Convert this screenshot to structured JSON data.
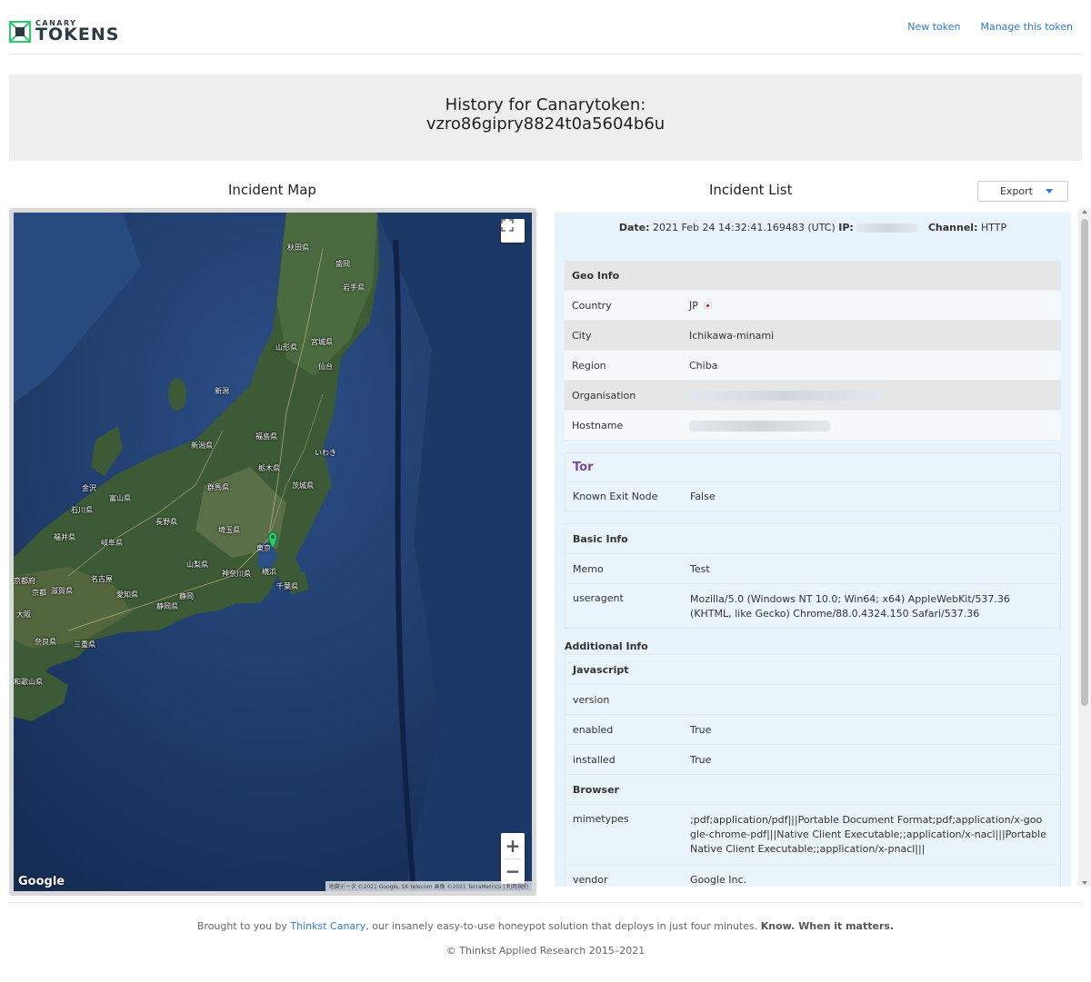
{
  "header": {
    "logo_small": "CANARY",
    "logo_big": "TOKENS",
    "nav": [
      "New token",
      "Manage this token"
    ]
  },
  "banner": {
    "line1": "History for Canarytoken:",
    "line2": "vzro86gipry8824t0a5604b6u"
  },
  "map": {
    "title": "Incident Map",
    "google_label": "Google",
    "attribution": "地図データ ©2021 Google, SK telecom 画像 ©2021 TerraMetrics  |  利用規約",
    "cities": [
      "秋田県",
      "盛岡",
      "岩手県",
      "山形県",
      "宮城県",
      "仙台",
      "新潟",
      "福島県",
      "新潟県",
      "栃木県",
      "いわき",
      "金沢",
      "富山県",
      "石川県",
      "群馬県",
      "茨城県",
      "長野県",
      "福井県",
      "岐阜県",
      "埼玉県",
      "東京",
      "山梨県",
      "神奈川県",
      "横浜",
      "千葉県",
      "京都府",
      "名古屋",
      "京都",
      "滋賀県",
      "愛知県",
      "静岡県",
      "静岡",
      "大阪",
      "奈良県",
      "三重県",
      "和歌山県"
    ]
  },
  "list": {
    "title": "Incident List",
    "export_label": "Export",
    "meta": {
      "date_label": "Date:",
      "date_value": "2021 Feb 24 14:32:41.169483 (UTC)",
      "ip_label": "IP:",
      "channel_label": "Channel:",
      "channel_value": "HTTP"
    },
    "geo": {
      "heading": "Geo Info",
      "country_k": "Country",
      "country_v": "JP",
      "city_k": "City",
      "city_v": "Ichikawa-minami",
      "region_k": "Region",
      "region_v": "Chiba",
      "org_k": "Organisation",
      "host_k": "Hostname"
    },
    "tor": {
      "logo": "Tor",
      "exit_k": "Known Exit Node",
      "exit_v": "False"
    },
    "basic": {
      "heading": "Basic Info",
      "memo_k": "Memo",
      "memo_v": "Test",
      "ua_k": "useragent",
      "ua_v": "Mozilla/5.0 (Windows NT 10.0; Win64; x64) AppleWebKit/537.36 (KHTML, like Gecko) Chrome/88.0.4324.150 Safari/537.36"
    },
    "additional": {
      "heading": "Additional Info",
      "js_heading": "Javascript",
      "version_k": "version",
      "version_v": "",
      "enabled_k": "enabled",
      "enabled_v": "True",
      "installed_k": "installed",
      "installed_v": "True",
      "browser_heading": "Browser",
      "mime_k": "mimetypes",
      "mime_v": ";pdf;application/pdf|||Portable Document Format;pdf;application/x-google-chrome-pdf|||Native Client Executable;;application/x-nacl|||Portable Native Client Executable;;application/x-pnacl|||",
      "vendor_k": "vendor",
      "vendor_v": "Google Inc."
    }
  },
  "footer": {
    "pre": "Brought to you by ",
    "link": "Thinkst Canary",
    "mid": ", our insanely easy-to-use honeypot solution that deploys in just four minutes. ",
    "bold": "Know. When it matters.",
    "copyright": "© Thinkst Applied Research 2015–2021"
  },
  "colors": {
    "link": "#2b7bd4",
    "brand": "#2a3b44",
    "accent": "#2ecc71"
  }
}
